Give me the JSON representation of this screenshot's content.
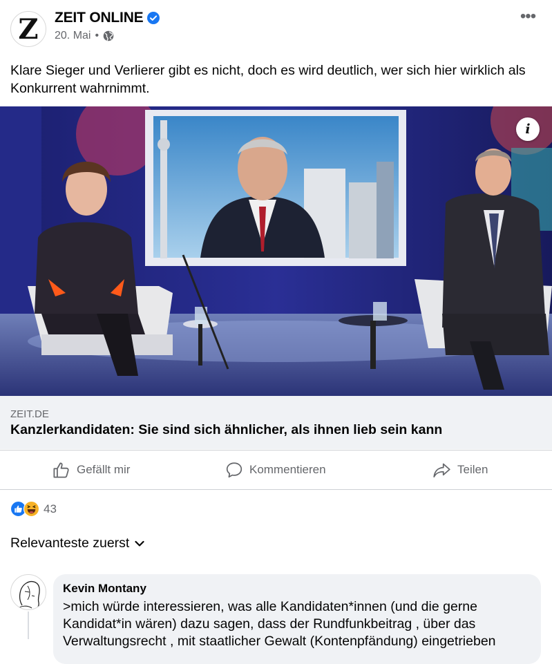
{
  "post": {
    "page_name": "ZEIT ONLINE",
    "avatar_letter": "Z",
    "date": "20. Mai",
    "separator": "•",
    "text": "Klare Sieger und Verlierer gibt es nicht, doch es wird deutlich, wer sich hier wirklich als Konkurrent wahrnimmt."
  },
  "link": {
    "domain": "ZEIT.DE",
    "title": "Kanzlerkandidaten: Sie sind sich ähnlicher, als ihnen lieb sein kann"
  },
  "photo": {
    "info_label": "i"
  },
  "actions": {
    "like": "Gefällt mir",
    "comment": "Kommentieren",
    "share": "Teilen"
  },
  "reactions": {
    "count": "43",
    "types": [
      "like",
      "haha"
    ]
  },
  "sort": {
    "label": "Relevanteste zuerst"
  },
  "comment": {
    "author": "Kevin Montany",
    "text": ">mich würde interessieren, was alle Kandidaten*innen (und die  gerne Kandidat*in  wären) dazu sagen, dass der Rundfunkbeitrag , über das Verwaltungsrecht , mit staatlicher Gewalt (Kontenpfändung) eingetrieben"
  },
  "colors": {
    "verified": "#1877f2",
    "like_blue": "#1877f2",
    "haha_yellow": "#f7b125",
    "muted_text": "#65676b",
    "link_bg": "#f0f2f5"
  }
}
